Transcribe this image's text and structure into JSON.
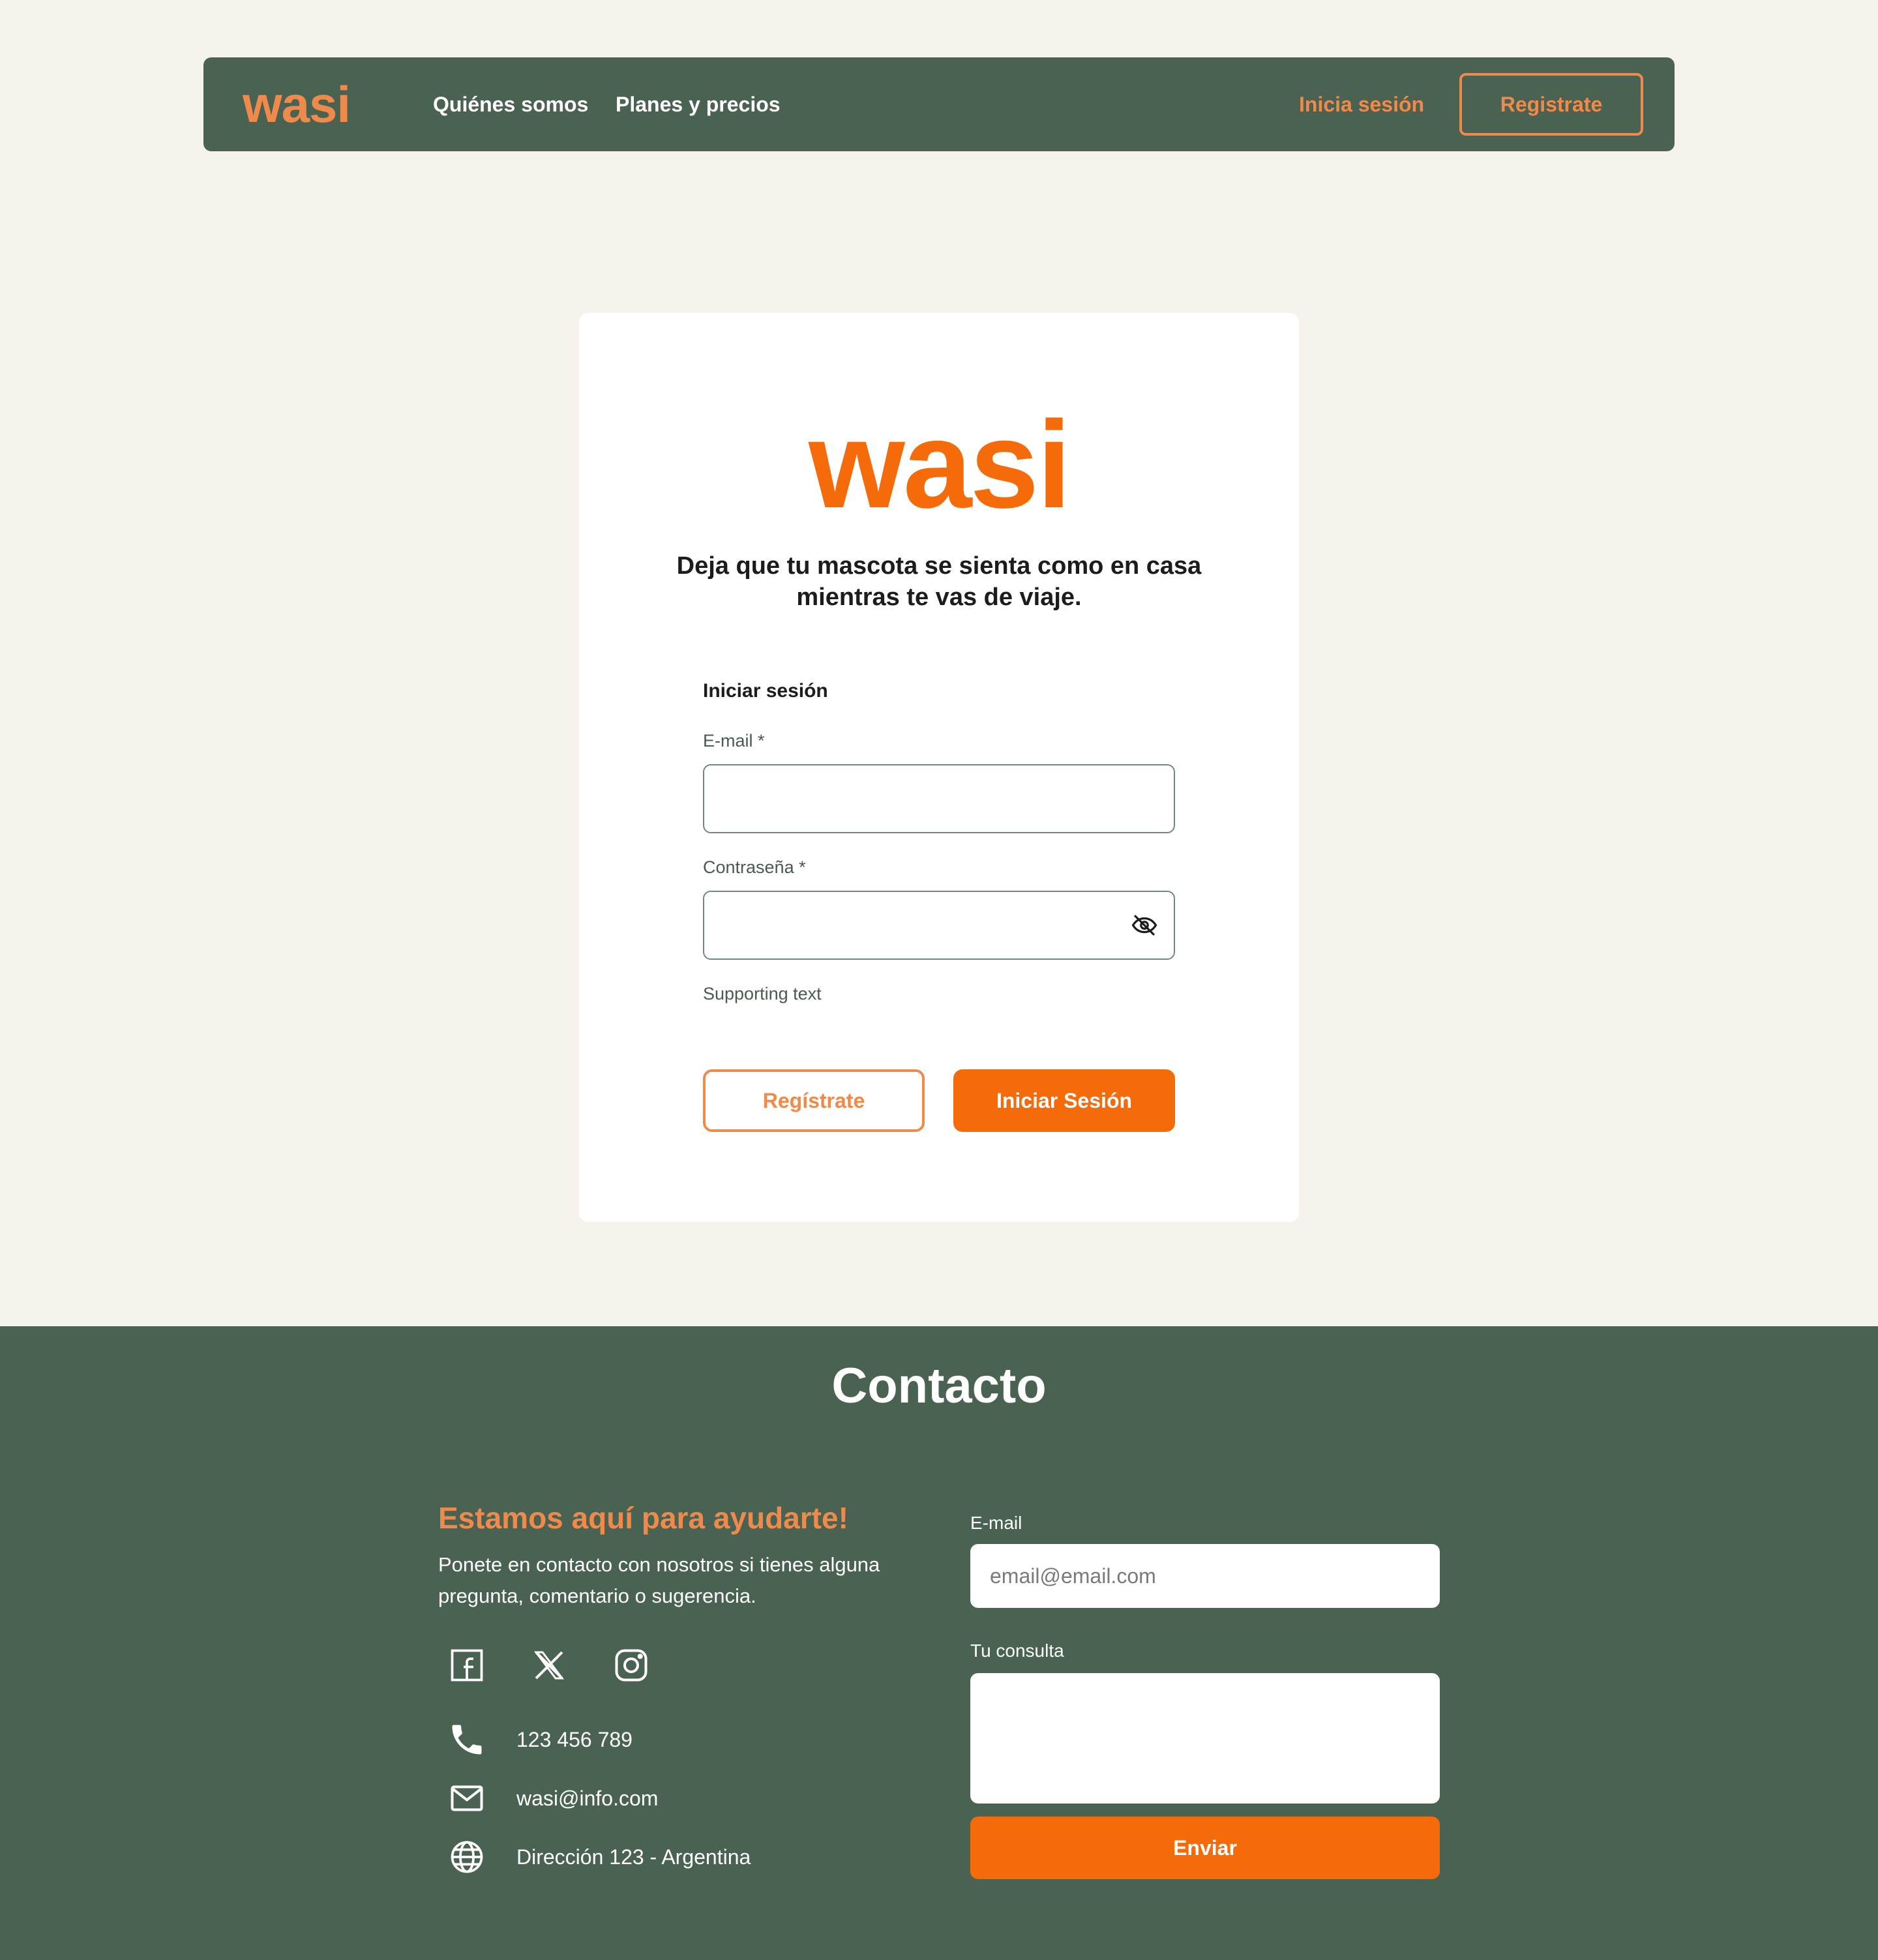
{
  "navbar": {
    "logo": "wasi",
    "links": [
      "Quiénes somos",
      "Planes y precios"
    ],
    "login": "Inicia sesión",
    "register": "Registrate"
  },
  "login_card": {
    "logo": "wasi",
    "tagline": "Deja que tu mascota se sienta como en casa mientras te vas de viaje.",
    "form_title": "Iniciar sesión",
    "email_label": "E-mail *",
    "password_label": "Contraseña *",
    "supporting_text": "Supporting text",
    "register_button": "Regístrate",
    "login_button": "Iniciar Sesión"
  },
  "footer": {
    "title": "Contacto",
    "help_title": "Estamos aquí para ayudarte!",
    "help_text": "Ponete en contacto con nosotros si tienes alguna pregunta, comentario o sugerencia.",
    "social": [
      "facebook-icon",
      "x-icon",
      "instagram-icon"
    ],
    "phone": "123 456 789",
    "email": "wasi@info.com",
    "address": "Dirección 123 - Argentina",
    "form": {
      "email_label": "E-mail",
      "email_placeholder": "email@email.com",
      "query_label": "Tu consulta",
      "submit": "Enviar"
    }
  },
  "colors": {
    "background": "#f6f3ed",
    "green": "#4a6252",
    "orange": "#f56a09",
    "light_orange": "#f08a4b"
  }
}
